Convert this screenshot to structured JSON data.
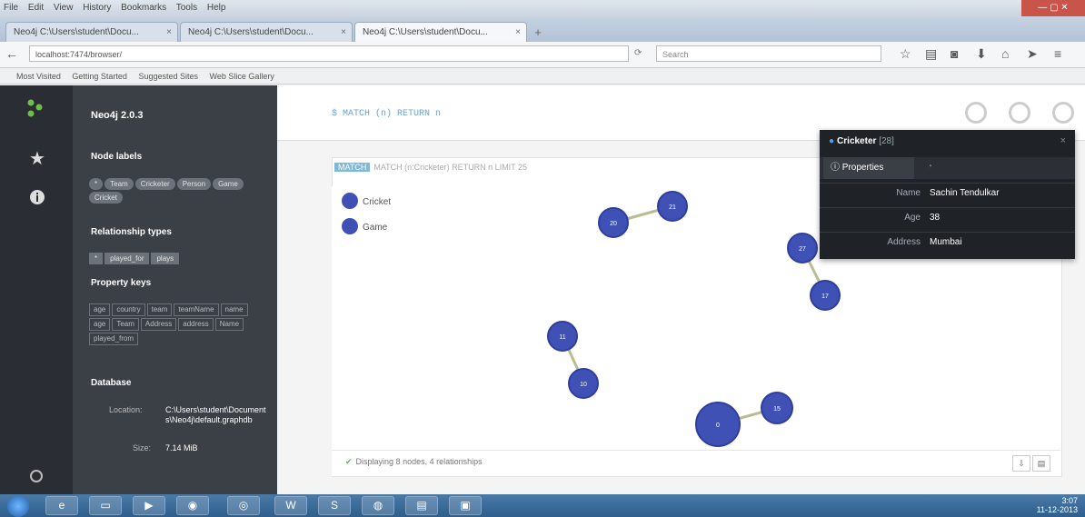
{
  "browser": {
    "menu": [
      "File",
      "Edit",
      "View",
      "History",
      "Bookmarks",
      "Tools",
      "Help"
    ],
    "tabs": [
      {
        "label": "Neo4j C:\\Users\\student\\Docu...",
        "active": false
      },
      {
        "label": "Neo4j C:\\Users\\student\\Docu...",
        "active": false
      },
      {
        "label": "Neo4j C:\\Users\\student\\Docu...",
        "active": true
      }
    ],
    "url": "localhost:7474/browser/",
    "search_placeholder": "Search",
    "bookmarks": [
      "Most Visited",
      "Getting Started",
      "Suggested Sites",
      "Web Slice Gallery"
    ]
  },
  "app": {
    "version": "Neo4j 2.0.3",
    "sidebar": {
      "node_labels_title": "Node labels",
      "node_labels": [
        "*",
        "Team",
        "Cricketer",
        "Person",
        "Game",
        "Cricket"
      ],
      "rel_types_title": "Relationship types",
      "rel_types": [
        "*",
        "played_for",
        "plays"
      ],
      "property_keys_title": "Property keys",
      "property_keys": [
        "age",
        "country",
        "team",
        "teamName",
        "name",
        "age",
        "Team",
        "Address",
        "address",
        "Name",
        "played_from"
      ],
      "database_title": "Database",
      "location_label": "Location:",
      "location_value": "C:\\Users\\student\\Documents\\Neo4j\\default.graphdb",
      "size_label": "Size:",
      "size_value": "7.14 MiB"
    },
    "editor_text": "$ MATCH (n) RETURN n",
    "frame_command": "MATCH (n:Cricketer) RETURN n LIMIT 25",
    "frame_tag": "MATCH",
    "legend": [
      {
        "label": "Cricket",
        "color": "#3f51b5"
      },
      {
        "label": "Game",
        "color": "#3f51b5"
      }
    ],
    "nodes": [
      {
        "id": "n1",
        "label": "21"
      },
      {
        "id": "n2",
        "label": "20"
      },
      {
        "id": "n3",
        "label": "27"
      },
      {
        "id": "n4",
        "label": "17"
      },
      {
        "id": "n5",
        "label": "11"
      },
      {
        "id": "n6",
        "label": "10"
      },
      {
        "id": "n7",
        "label": "15"
      },
      {
        "id": "n8",
        "label": "0"
      }
    ],
    "status": "Displaying 8 nodes, 4 relationships",
    "inspector": {
      "title": "Cricketer",
      "id": "[28]",
      "tab_properties": "Properties",
      "properties": [
        {
          "key": "Name",
          "value": "Sachin Tendulkar"
        },
        {
          "key": "Age",
          "value": "38"
        },
        {
          "key": "Address",
          "value": "Mumbai"
        }
      ]
    }
  },
  "taskbar": {
    "time": "3:07",
    "date": "11-12-2013"
  }
}
